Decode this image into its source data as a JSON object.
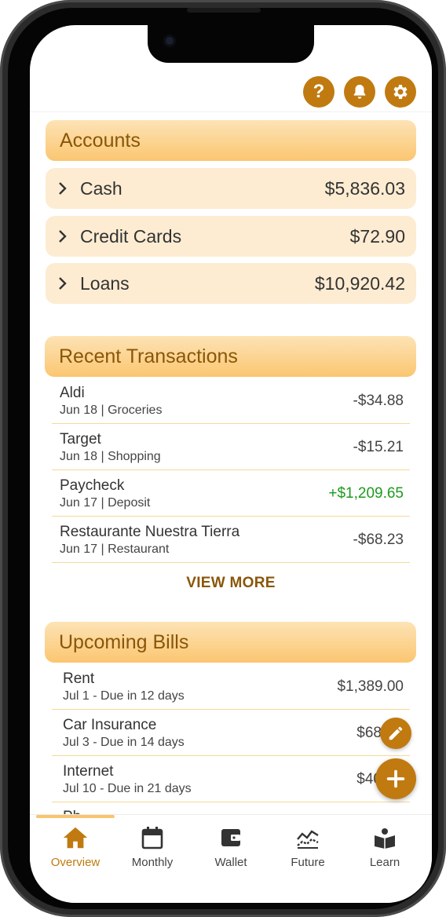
{
  "accounts": {
    "title": "Accounts",
    "items": [
      {
        "name": "Cash",
        "amount": "$5,836.03"
      },
      {
        "name": "Credit Cards",
        "amount": "$72.90"
      },
      {
        "name": "Loans",
        "amount": "$10,920.42"
      }
    ]
  },
  "recent": {
    "title": "Recent Transactions",
    "items": [
      {
        "name": "Aldi",
        "sub": "Jun 18 | Groceries",
        "amount": "-$34.88"
      },
      {
        "name": "Target",
        "sub": "Jun 18 | Shopping",
        "amount": "-$15.21"
      },
      {
        "name": "Paycheck",
        "sub": "Jun 17 | Deposit",
        "amount": "+$1,209.65"
      },
      {
        "name": "Restaurante Nuestra Tierra",
        "sub": "Jun 17 | Restaurant",
        "amount": "-$68.23"
      }
    ],
    "view_more": "VIEW MORE"
  },
  "bills": {
    "title": "Upcoming Bills",
    "items": [
      {
        "name": "Rent",
        "sub": "Jul 1 - Due in 12 days",
        "amount": "$1,389.00"
      },
      {
        "name": "Car Insurance",
        "sub": "Jul 3 - Due in 14 days",
        "amount": "$68"
      },
      {
        "name": "Internet",
        "sub": "Jul 10 - Due in 21 days",
        "amount": "$40"
      },
      {
        "name": "Ph"
      }
    ]
  },
  "nav": {
    "items": [
      {
        "label": "Overview",
        "icon": "home-icon"
      },
      {
        "label": "Monthly",
        "icon": "calendar-icon"
      },
      {
        "label": "Wallet",
        "icon": "wallet-icon"
      },
      {
        "label": "Future",
        "icon": "chart-icon"
      },
      {
        "label": "Learn",
        "icon": "book-icon"
      }
    ],
    "active": "Overview"
  },
  "top_buttons": [
    "help-icon",
    "bell-icon",
    "gear-icon"
  ],
  "colors": {
    "accent": "#c07a10",
    "header_gradient_top": "#fde3b5",
    "header_gradient_bottom": "#fbc671",
    "row_bg": "#fdecd2",
    "positive": "#1e9a1e",
    "divider": "#f5d999"
  }
}
